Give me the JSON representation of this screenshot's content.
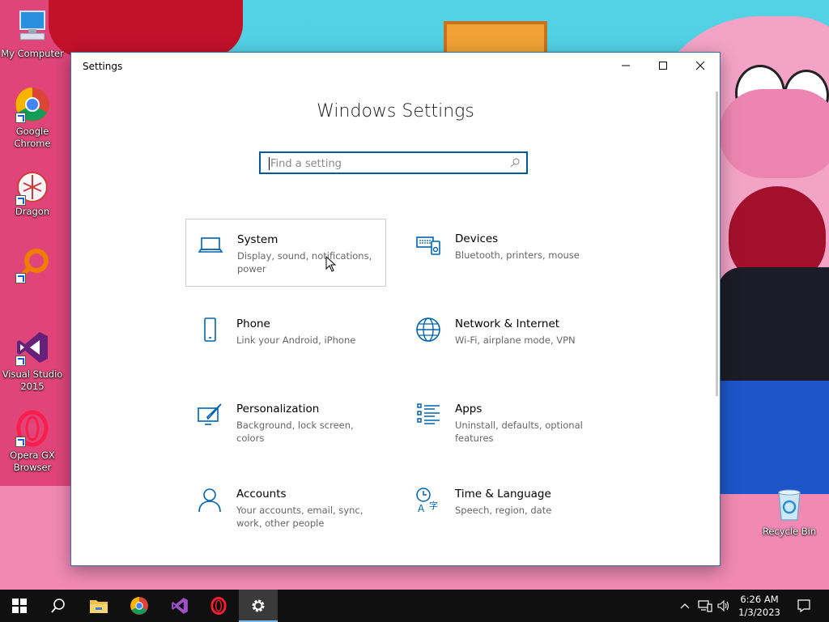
{
  "desktop": {
    "icons": [
      {
        "label": "My Computer",
        "icon": "computer-icon"
      },
      {
        "label": "Google Chrome",
        "icon": "chrome-icon"
      },
      {
        "label": "Dragon",
        "icon": "dragon-icon"
      },
      {
        "label": "",
        "icon": "search-app-icon"
      },
      {
        "label": "Visual Studio 2015",
        "icon": "visual-studio-icon"
      },
      {
        "label": "Opera GX Browser",
        "icon": "opera-gx-icon"
      },
      {
        "label": "Recycle Bin",
        "icon": "recycle-bin-icon"
      }
    ]
  },
  "window": {
    "title": "Settings",
    "controls": [
      "minimize-icon",
      "maximize-icon",
      "close-icon"
    ]
  },
  "settings": {
    "heading": "Windows Settings",
    "search": {
      "placeholder": "Find a setting",
      "value": ""
    },
    "categories": [
      {
        "name": "System",
        "description": "Display, sound, notifications, power",
        "icon": "laptop-icon"
      },
      {
        "name": "Devices",
        "description": "Bluetooth, printers, mouse",
        "icon": "devices-icon"
      },
      {
        "name": "Phone",
        "description": "Link your Android, iPhone",
        "icon": "phone-icon"
      },
      {
        "name": "Network & Internet",
        "description": "Wi-Fi, airplane mode, VPN",
        "icon": "globe-icon"
      },
      {
        "name": "Personalization",
        "description": "Background, lock screen, colors",
        "icon": "personalization-icon"
      },
      {
        "name": "Apps",
        "description": "Uninstall, defaults, optional features",
        "icon": "apps-list-icon"
      },
      {
        "name": "Accounts",
        "description": "Your accounts, email, sync, work, other people",
        "icon": "person-icon"
      },
      {
        "name": "Time & Language",
        "description": "Speech, region, date",
        "icon": "time-language-icon"
      }
    ]
  },
  "taskbar": {
    "apps": [
      "start-icon",
      "search-icon",
      "file-explorer-icon",
      "chrome-icon",
      "visual-studio-icon",
      "opera-icon",
      "settings-gear-icon"
    ],
    "clock": {
      "time": "6:26 AM",
      "date": "1/3/2023"
    },
    "tray": [
      "chevron-up-icon",
      "network-icon",
      "volume-icon",
      "notification-icon"
    ]
  },
  "colors": {
    "accent": "#0063b1",
    "taskbar": "#101010",
    "window_border": "#3a6ea5"
  }
}
